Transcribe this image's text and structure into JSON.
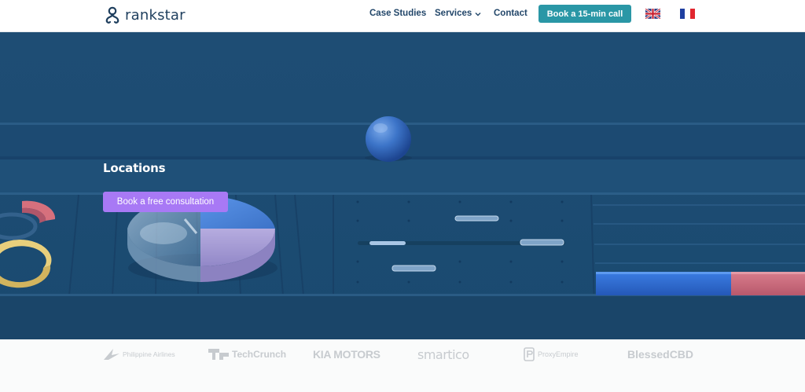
{
  "header": {
    "logo_text": "rankstar",
    "nav": {
      "case_studies": "Case Studies",
      "services": "Services",
      "contact": "Contact"
    },
    "cta_label": "Book a 15-min call",
    "languages": [
      "en",
      "fr"
    ]
  },
  "hero": {
    "title": "Locations",
    "button_label": "Book a free consultation"
  },
  "clients": {
    "philippine": "Philippine Airlines",
    "techcrunch": "TechCrunch",
    "kia": "KIA MOTORS",
    "smartico": "smartico",
    "proxyempire": "ProxyEmpire",
    "blessedcbd": "BlessedCBD"
  },
  "colors": {
    "brand_navy": "#1f3f5e",
    "cta_teal": "#2a97a6",
    "hero_blue": "#1f5078",
    "hero_button_purple": "#a879f5",
    "logo_grey": "#c7cbcf"
  }
}
